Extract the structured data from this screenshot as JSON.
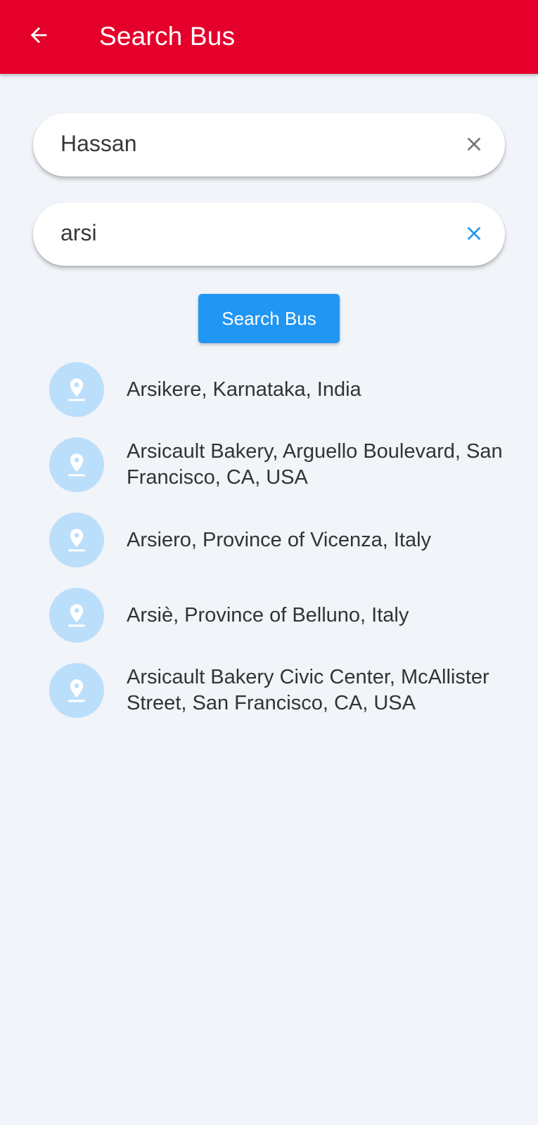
{
  "app_bar": {
    "title": "Search Bus",
    "back_icon": "arrow-back-icon",
    "background_color": "#e4002b"
  },
  "from_field": {
    "value": "Hassan",
    "clear_icon": "close-icon",
    "clear_icon_color": "#757575"
  },
  "to_field": {
    "value": "arsi",
    "clear_icon": "close-icon",
    "clear_icon_color": "#2196f3"
  },
  "search_button": {
    "label": "Search Bus",
    "color": "#2196f3"
  },
  "suggestions": {
    "icon": "location-pin-icon",
    "icon_background": "#bbdefb",
    "items": [
      {
        "label": "Arsikere, Karnataka, India"
      },
      {
        "label": "Arsicault Bakery, Arguello Boulevard, San Francisco, CA, USA"
      },
      {
        "label": "Arsiero, Province of Vicenza, Italy"
      },
      {
        "label": "Arsiè, Province of Belluno, Italy"
      },
      {
        "label": "Arsicault Bakery Civic Center, McAllister Street, San Francisco, CA, USA"
      }
    ]
  }
}
